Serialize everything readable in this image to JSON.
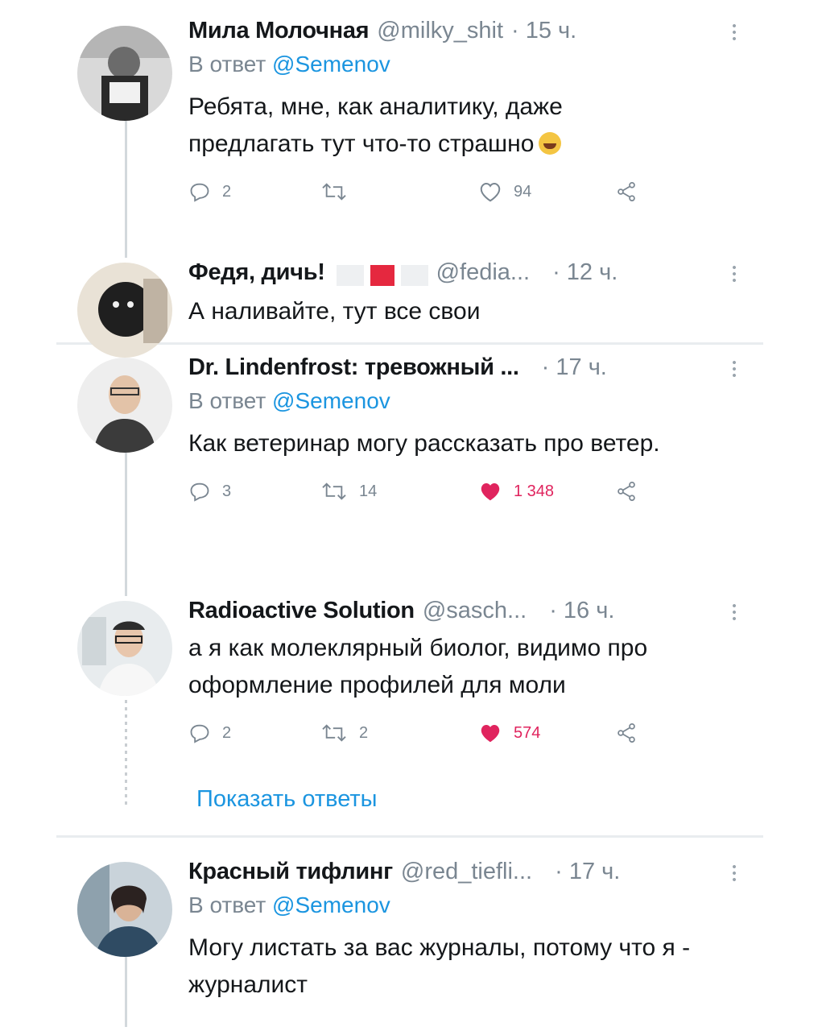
{
  "colors": {
    "accent": "#1b95e0",
    "muted": "#7a8691",
    "like": "#e0245e"
  },
  "tweets": [
    {
      "name": "Мила Молочная",
      "handle": "@milky_shit",
      "time": "· 15 ч.",
      "reply_label": "В ответ",
      "reply_mention": "@Semenov",
      "text": "Ребята, мне, как аналитику, даже предлагать тут что-то страшно",
      "emoji": "face-with-tears-of-joy-icon",
      "replies": "2",
      "retweets": "",
      "likes": "94",
      "liked": false
    },
    {
      "name": "Федя, дичь!",
      "handle": "@fedia...",
      "time": "· 12 ч.",
      "text": "А наливайте, тут все свои"
    },
    {
      "name": "Dr. Lindenfrost: тревожный ...",
      "handle": "",
      "time": "· 17 ч.",
      "reply_label": "В ответ",
      "reply_mention": "@Semenov",
      "text": "Как ветеринар могу рассказать про ветер.",
      "replies": "3",
      "retweets": "14",
      "likes": "1 348",
      "liked": true
    },
    {
      "name": "Radioactive Solution",
      "handle": "@sasch...",
      "time": "· 16 ч.",
      "text": "а я как молеклярный биолог, видимо про оформление профилей для моли",
      "replies": "2",
      "retweets": "2",
      "likes": "574",
      "liked": true
    },
    {
      "name": "Красный тифлинг",
      "handle": "@red_tiefli...",
      "time": "· 17 ч.",
      "reply_label": "В ответ",
      "reply_mention": "@Semenov",
      "text": "Могу листать за вас журналы, потому что я - журналист"
    }
  ],
  "show_replies_label": "Показать ответы",
  "icons": {
    "reply": "reply-icon",
    "retweet": "retweet-icon",
    "like": "heart-icon",
    "share": "share-icon",
    "more": "more-vertical-icon"
  }
}
